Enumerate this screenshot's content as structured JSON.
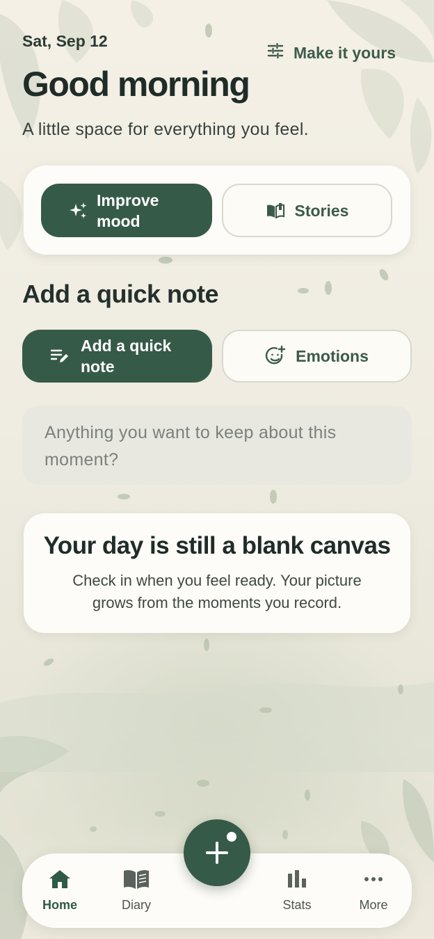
{
  "header": {
    "date": "Sat, Sep 12",
    "customize_label": "Make it yours",
    "greeting": "Good morning",
    "subtitle": "A little space for everything you feel."
  },
  "top_actions": {
    "improve_mood_label": "Improve mood",
    "stories_label": "Stories"
  },
  "quick_note": {
    "section_title": "Add a quick note",
    "add_note_label": "Add a quick note",
    "emotions_label": "Emotions",
    "input_placeholder": "Anything you want to keep about this moment?"
  },
  "empty_state": {
    "title": "Your day is still a blank canvas",
    "message": "Check in when you feel ready. Your picture grows from the moments you record."
  },
  "bottom_nav": {
    "items": [
      {
        "label": "Home",
        "icon": "home-icon",
        "active": true
      },
      {
        "label": "Diary",
        "icon": "book-icon",
        "active": false
      },
      {
        "label": "Stats",
        "icon": "bar-chart-icon",
        "active": false
      },
      {
        "label": "More",
        "icon": "more-horiz-icon",
        "active": false
      }
    ],
    "fab_icon": "plus-icon"
  },
  "colors": {
    "primary": "#365a48",
    "background": "#f3efe5",
    "card": "#fdfcf8"
  }
}
